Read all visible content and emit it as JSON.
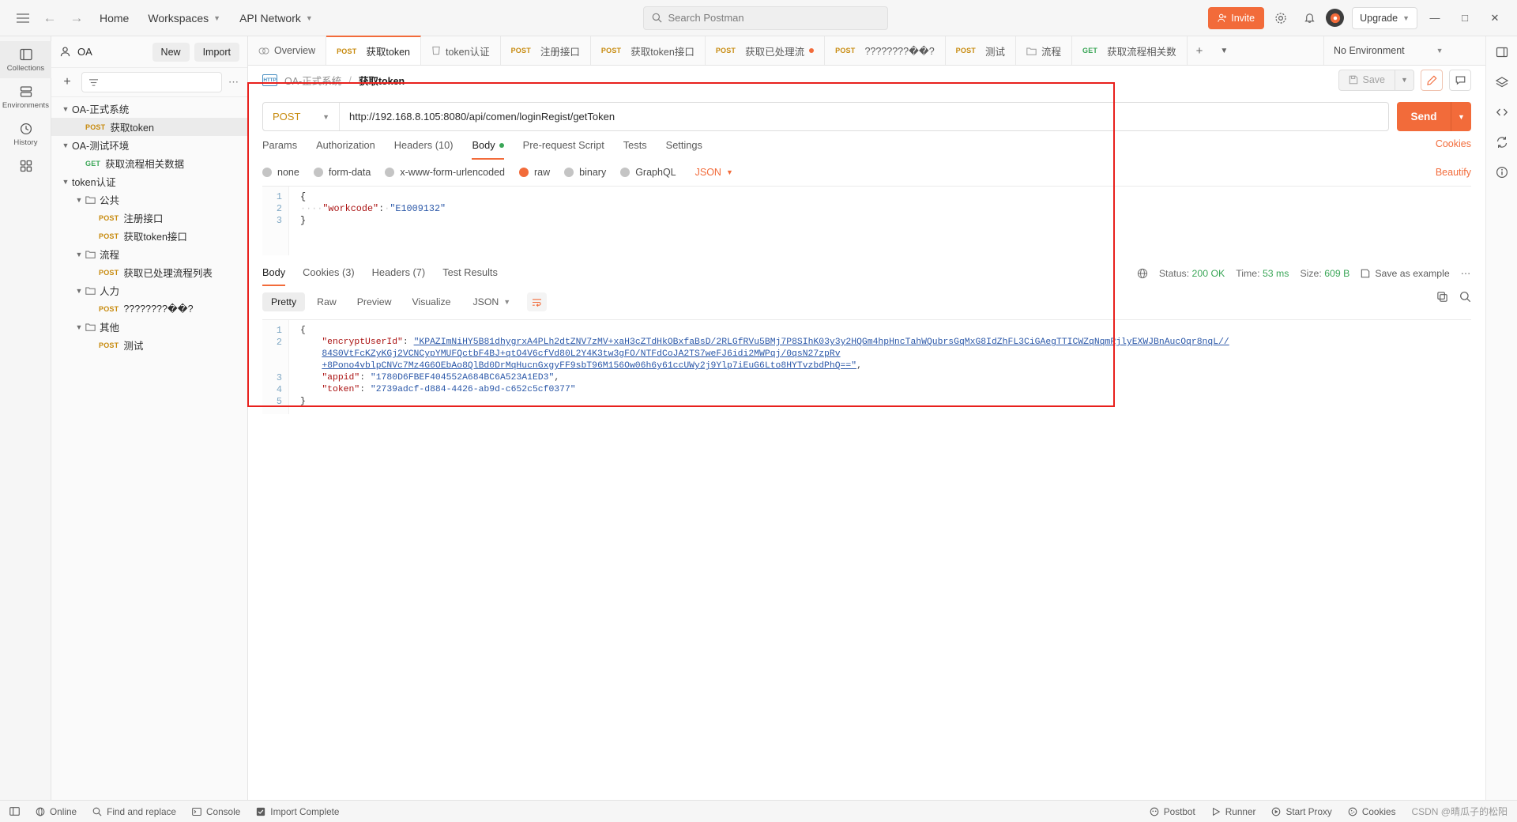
{
  "topbar": {
    "menu_icon": "hamburger-icon",
    "back_icon": "arrow-left-icon",
    "forward_icon": "arrow-right-icon",
    "home": "Home",
    "workspaces": "Workspaces",
    "api_network": "API Network",
    "search_placeholder": "Search Postman",
    "invite": "Invite",
    "upgrade": "Upgrade",
    "avatar_initial": "",
    "minimize": "—",
    "maximize": "☐",
    "close": "✕"
  },
  "rail": {
    "items": [
      {
        "label": "Collections",
        "icon": "collections-icon",
        "active": true
      },
      {
        "label": "Environments",
        "icon": "environments-icon",
        "active": false
      },
      {
        "label": "History",
        "icon": "history-icon",
        "active": false
      },
      {
        "label": "",
        "icon": "apps-grid-icon",
        "active": false
      }
    ]
  },
  "sidebar": {
    "user": "OA",
    "new_button": "New",
    "import_button": "Import",
    "plus_icon": "plus-icon",
    "filter_icon": "filter-icon",
    "more_icon": "more-horizontal-icon",
    "filter_placeholder": "",
    "tree": [
      {
        "indent": 0,
        "chev": true,
        "folder": false,
        "method": "",
        "label": "OA-正式系统",
        "selected": false
      },
      {
        "indent": 1,
        "chev": false,
        "folder": false,
        "method": "POST",
        "label": "获取token",
        "selected": true
      },
      {
        "indent": 0,
        "chev": true,
        "folder": false,
        "method": "",
        "label": "OA-测试环境",
        "selected": false
      },
      {
        "indent": 1,
        "chev": false,
        "folder": false,
        "method": "GET",
        "label": "获取流程相关数据",
        "selected": false
      },
      {
        "indent": 0,
        "chev": true,
        "folder": false,
        "method": "",
        "label": "token认证",
        "selected": false
      },
      {
        "indent": 1,
        "chev": true,
        "folder": true,
        "method": "",
        "label": "公共",
        "selected": false
      },
      {
        "indent": 2,
        "chev": false,
        "folder": false,
        "method": "POST",
        "label": "注册接口",
        "selected": false
      },
      {
        "indent": 2,
        "chev": false,
        "folder": false,
        "method": "POST",
        "label": "获取token接口",
        "selected": false
      },
      {
        "indent": 1,
        "chev": true,
        "folder": true,
        "method": "",
        "label": "流程",
        "selected": false
      },
      {
        "indent": 2,
        "chev": false,
        "folder": false,
        "method": "POST",
        "label": "获取已处理流程列表",
        "selected": false
      },
      {
        "indent": 1,
        "chev": true,
        "folder": true,
        "method": "",
        "label": "人力",
        "selected": false
      },
      {
        "indent": 2,
        "chev": false,
        "folder": false,
        "method": "POST",
        "label": "????????��?",
        "selected": false
      },
      {
        "indent": 1,
        "chev": true,
        "folder": true,
        "method": "",
        "label": "其他",
        "selected": false
      },
      {
        "indent": 2,
        "chev": false,
        "folder": false,
        "method": "POST",
        "label": "测试",
        "selected": false
      }
    ]
  },
  "tabs": {
    "items": [
      {
        "method": "",
        "icon": "overview-icon",
        "label": "Overview",
        "active": false,
        "dirty": false
      },
      {
        "method": "POST",
        "icon": "",
        "label": "获取token",
        "active": true,
        "dirty": false
      },
      {
        "method": "",
        "icon": "collection-icon",
        "label": "token认证",
        "active": false,
        "dirty": false
      },
      {
        "method": "POST",
        "icon": "",
        "label": "注册接口",
        "active": false,
        "dirty": false
      },
      {
        "method": "POST",
        "icon": "",
        "label": "获取token接口",
        "active": false,
        "dirty": false
      },
      {
        "method": "POST",
        "icon": "",
        "label": "获取已处理流",
        "active": false,
        "dirty": true
      },
      {
        "method": "POST",
        "icon": "",
        "label": "????????��?",
        "active": false,
        "dirty": false
      },
      {
        "method": "POST",
        "icon": "",
        "label": "测试",
        "active": false,
        "dirty": false
      },
      {
        "method": "",
        "icon": "folder-icon",
        "label": "流程",
        "active": false,
        "dirty": false
      },
      {
        "method": "GET",
        "icon": "",
        "label": "获取流程相关数",
        "active": false,
        "dirty": false
      }
    ],
    "add_icon": "plus-icon",
    "caret_icon": "chevron-down-icon",
    "environment": "No Environment"
  },
  "breadcrumb": {
    "protocol_badge": "HTTP",
    "collection": "OA-正式系统",
    "separator": "/",
    "current": "获取token",
    "save_label": "Save",
    "save_icon": "save-icon",
    "save_caret": "chevron-down-icon",
    "edit_icon": "pencil-icon",
    "comment_icon": "comment-icon"
  },
  "request": {
    "method": "POST",
    "url": "http://192.168.8.105:8080/api/comen/loginRegist/getToken",
    "send_label": "Send",
    "send_caret": "chevron-down-icon",
    "tabs": [
      {
        "label": "Params",
        "active": false,
        "badge": ""
      },
      {
        "label": "Authorization",
        "active": false,
        "badge": ""
      },
      {
        "label": "Headers (10)",
        "active": false,
        "badge": ""
      },
      {
        "label": "Body",
        "active": true,
        "badge": "dot"
      },
      {
        "label": "Pre-request Script",
        "active": false,
        "badge": ""
      },
      {
        "label": "Tests",
        "active": false,
        "badge": ""
      },
      {
        "label": "Settings",
        "active": false,
        "badge": ""
      }
    ],
    "cookies_link": "Cookies",
    "body_types": [
      {
        "label": "none",
        "selected": false
      },
      {
        "label": "form-data",
        "selected": false
      },
      {
        "label": "x-www-form-urlencoded",
        "selected": false
      },
      {
        "label": "raw",
        "selected": true
      },
      {
        "label": "binary",
        "selected": false
      },
      {
        "label": "GraphQL",
        "selected": false
      }
    ],
    "raw_format": "JSON",
    "beautify": "Beautify",
    "body_lines": [
      {
        "n": "1",
        "html": "{"
      },
      {
        "n": "2",
        "html": "<span class=\"ws\">····</span><span class=\"k\">\"workcode\"</span><span class=\"p\">:</span><span class=\"ws\">·</span><span class=\"s\">\"E1009132\"</span>"
      },
      {
        "n": "3",
        "html": "}"
      }
    ]
  },
  "response": {
    "tabs": [
      {
        "label": "Body",
        "active": true
      },
      {
        "label": "Cookies (3)",
        "active": false
      },
      {
        "label": "Headers (7)",
        "active": false
      },
      {
        "label": "Test Results",
        "active": false
      }
    ],
    "status_icon": "globe-icon",
    "status_label": "Status:",
    "status_value": "200 OK",
    "time_label": "Time:",
    "time_value": "53 ms",
    "size_label": "Size:",
    "size_value": "609 B",
    "save_example": "Save as example",
    "more_icon": "more-horizontal-icon",
    "view_pills": [
      {
        "label": "Pretty",
        "active": true
      },
      {
        "label": "Raw",
        "active": false
      },
      {
        "label": "Preview",
        "active": false
      },
      {
        "label": "Visualize",
        "active": false
      }
    ],
    "format": "JSON",
    "wrap_icon": "wrap-lines-icon",
    "copy_icon": "copy-icon",
    "search_icon": "search-icon",
    "body_lines": [
      {
        "n": "1",
        "html": "{"
      },
      {
        "n": "2",
        "html": "    <span class=\"k\">\"encryptUserId\"</span><span class=\"p\">:</span> <span class=\"s link-u\">\"KPAZImNiHY5B81dhygrxA4PLh2dtZNV7zMV+xaH3cZTdHkOBxfaBsD/2RLGfRVu5BMj7P8SIhK03y3y2HQGm4hpHncTahWQubrsGqMxG8IdZhFL3CiGAegTTICWZqNqmRjlyEXWJBnAucOqr8nqL//</span>"
      },
      {
        "n": "",
        "html": "    <span class=\"s link-u\">84S0VtFcKZyKGj2VCNCypYMUFQctbF4BJ+qtO4V6cfVd80L2Y4K3tw3gFO/NTFdCoJA2TS7weFJ6idi2MWPqj/0qsN27zpRv</span>"
      },
      {
        "n": "",
        "html": "    <span class=\"s link-u\">+8Pono4vblpCNVc7Mz4G6OEbAo8QlBd0DrMqHucnGxgyFF9sbT96M156Ow06h6y61ccUWy2j9Ylp7iEuG6Lto8HYTvzbdPhQ==\"</span><span class=\"p\">,</span>"
      },
      {
        "n": "3",
        "html": "    <span class=\"k\">\"appid\"</span><span class=\"p\">:</span> <span class=\"s\">\"1780D6FBEF404552A684BC6A523A1ED3\"</span><span class=\"p\">,</span>"
      },
      {
        "n": "4",
        "html": "    <span class=\"k\">\"token\"</span><span class=\"p\">:</span> <span class=\"s\">\"2739adcf-d884-4426-ab9d-c652c5cf0377\"</span>"
      },
      {
        "n": "5",
        "html": "}"
      }
    ]
  },
  "right_rail": {
    "icons": [
      "panel-right-icon",
      "layers-icon",
      "code-icon",
      "sync-icon",
      "info-icon"
    ]
  },
  "statusbar": {
    "sidebar_toggle_icon": "panel-left-icon",
    "online": "Online",
    "find_replace": "Find and replace",
    "console": "Console",
    "import_complete": "Import Complete",
    "postbot": "Postbot",
    "runner": "Runner",
    "start_proxy": "Start Proxy",
    "cookies": "Cookies",
    "watermark": "CSDN @晴瓜子的松阳"
  },
  "colors": {
    "accent": "#f26b3a",
    "post": "#c78a0d",
    "get": "#3aa657",
    "ok": "#3aa657",
    "annotation": "#e8201c"
  }
}
